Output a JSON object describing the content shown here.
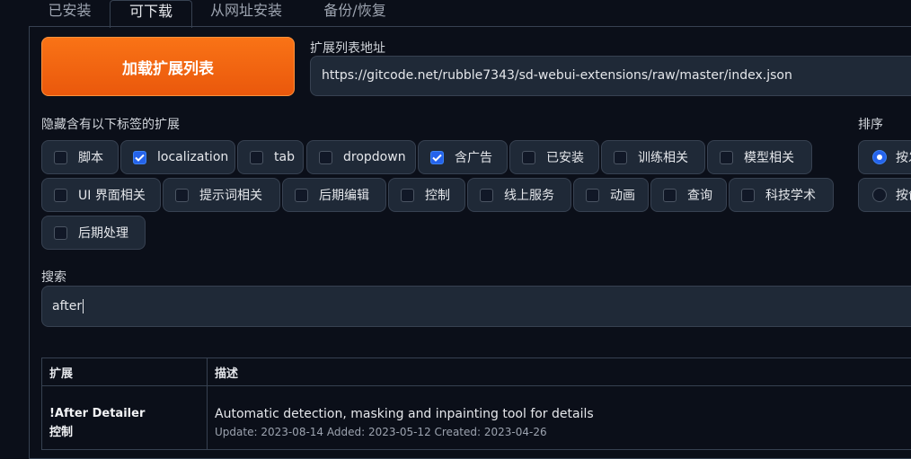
{
  "tabs": [
    "已安装",
    "可下载",
    "从网址安装",
    "备份/恢复"
  ],
  "active_tab_index": 1,
  "load_button_label": "加载扩展列表",
  "url_field": {
    "label": "扩展列表地址",
    "value": "https://gitcode.net/rubble7343/sd-webui-extensions/raw/master/index.json"
  },
  "hide_tags": {
    "label": "隐藏含有以下标签的扩展",
    "items": [
      {
        "label": "脚本",
        "checked": false
      },
      {
        "label": "localization",
        "checked": true
      },
      {
        "label": "tab",
        "checked": false
      },
      {
        "label": "dropdown",
        "checked": false
      },
      {
        "label": "含广告",
        "checked": true
      },
      {
        "label": "已安装",
        "checked": false
      },
      {
        "label": "训练相关",
        "checked": false
      },
      {
        "label": "模型相关",
        "checked": false
      },
      {
        "label": "UI 界面相关",
        "checked": false
      },
      {
        "label": "提示词相关",
        "checked": false
      },
      {
        "label": "后期编辑",
        "checked": false
      },
      {
        "label": "控制",
        "checked": false
      },
      {
        "label": "线上服务",
        "checked": false
      },
      {
        "label": "动画",
        "checked": false
      },
      {
        "label": "查询",
        "checked": false
      },
      {
        "label": "科技学术",
        "checked": false
      },
      {
        "label": "后期处理",
        "checked": false
      }
    ]
  },
  "sort": {
    "label": "排序",
    "options": [
      {
        "label": "按发",
        "checked": true
      },
      {
        "label": "按创",
        "checked": false
      }
    ]
  },
  "search": {
    "label": "搜索",
    "value": "after"
  },
  "table": {
    "headers": [
      "扩展",
      "描述"
    ],
    "rows": [
      {
        "name": "!After Detailer",
        "tag": "控制",
        "description": "Automatic detection, masking and inpainting tool for details",
        "meta": "Update: 2023-08-14 Added: 2023-05-12 Created: 2023-04-26"
      }
    ]
  },
  "colors": {
    "accent": "#f97316",
    "checkbox_on": "#2563eb",
    "background": "#0b0f19"
  }
}
